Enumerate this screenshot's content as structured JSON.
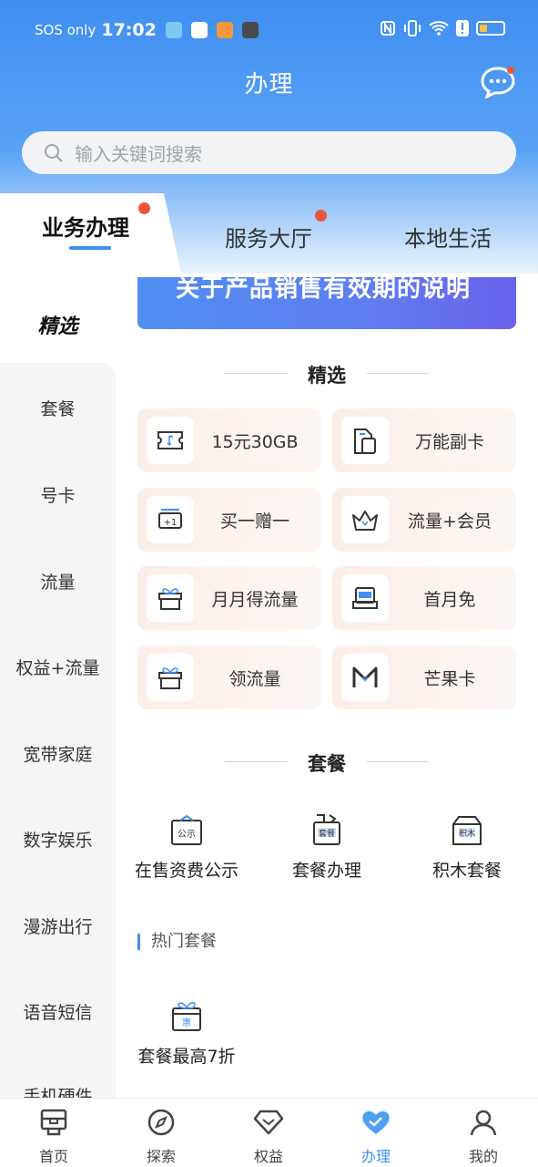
{
  "status_bar": {
    "carrier": "SOS only",
    "time": "17:02"
  },
  "header": {
    "title": "办理"
  },
  "search": {
    "placeholder": "输入关键词搜索"
  },
  "tabs": [
    {
      "label": "业务办理",
      "active": true,
      "dot": true
    },
    {
      "label": "服务大厅",
      "active": false,
      "dot": true
    },
    {
      "label": "本地生活",
      "active": false,
      "dot": false
    }
  ],
  "sidebar": {
    "items": [
      {
        "label": "精选"
      },
      {
        "label": "套餐"
      },
      {
        "label": "号卡"
      },
      {
        "label": "流量"
      },
      {
        "label": "权益+流量"
      },
      {
        "label": "宽带家庭"
      },
      {
        "label": "数字娱乐"
      },
      {
        "label": "漫游出行"
      },
      {
        "label": "语音短信"
      },
      {
        "label": "手机硬件"
      }
    ]
  },
  "banner": {
    "text": "关于产品销售有效期的说明"
  },
  "featured": {
    "title": "精选",
    "cards": [
      {
        "label": "15元30GB",
        "icon": "ticket-icon"
      },
      {
        "label": "万能副卡",
        "icon": "sim-card-icon"
      },
      {
        "label": "买一赠一",
        "icon": "plus-one-icon"
      },
      {
        "label": "流量+会员",
        "icon": "crown-icon"
      },
      {
        "label": "月月得流量",
        "icon": "gift-box-icon"
      },
      {
        "label": "首月免",
        "icon": "first-month-icon"
      },
      {
        "label": "领流量",
        "icon": "gift-box-icon"
      },
      {
        "label": "芒果卡",
        "icon": "mango-m-icon"
      }
    ]
  },
  "package": {
    "title": "套餐",
    "items": [
      {
        "label": "在售资费公示",
        "badge": "公示"
      },
      {
        "label": "套餐办理",
        "badge": "套餐"
      },
      {
        "label": "积木套餐",
        "badge": "积木"
      }
    ],
    "hot_title": "热门套餐",
    "hot_items": [
      {
        "label": "套餐最高7折",
        "badge": "惠"
      }
    ]
  },
  "bottom_nav": [
    {
      "label": "首页",
      "icon": "home-icon",
      "active": false
    },
    {
      "label": "探索",
      "icon": "compass-icon",
      "active": false
    },
    {
      "label": "权益",
      "icon": "diamond-icon",
      "active": false
    },
    {
      "label": "办理",
      "icon": "heart-icon",
      "active": true
    },
    {
      "label": "我的",
      "icon": "profile-icon",
      "active": false
    }
  ],
  "colors": {
    "primary": "#3f8ef0",
    "badge_red": "#e8553f",
    "sidebar_bg": "#f4f5f7",
    "card_bg": "#fbeee8"
  }
}
